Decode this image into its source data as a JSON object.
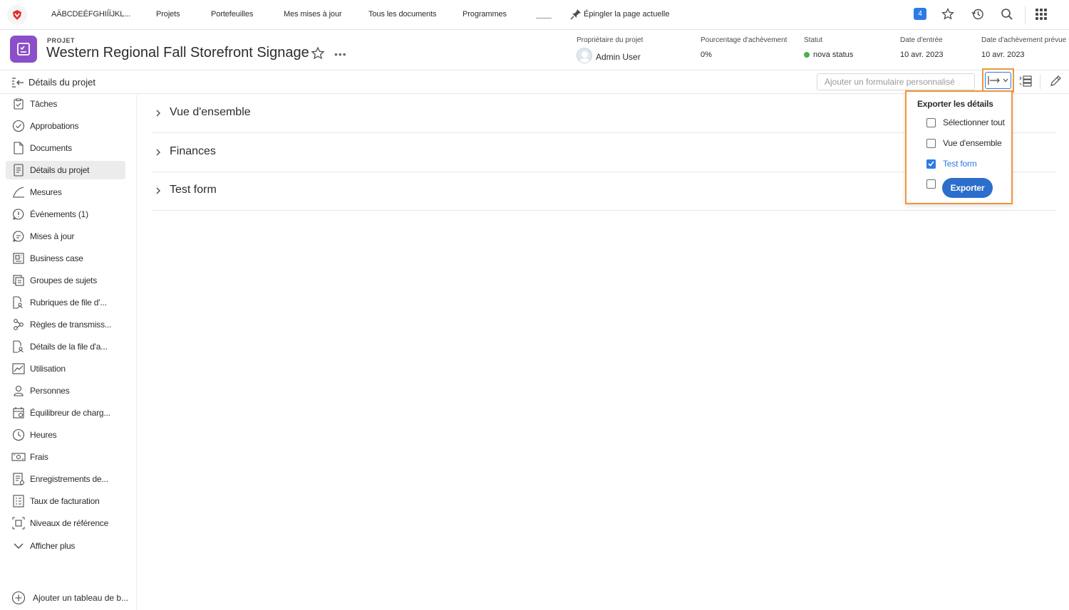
{
  "topnav": {
    "account_name": "AÄBCDEÉFGHIÍÏJKL...",
    "links": [
      "Projets",
      "Portefeuilles",
      "Mes mises à jour",
      "Tous les documents",
      "Programmes"
    ],
    "pin_label": "Épingler la page actuelle",
    "notification_count": "4"
  },
  "project": {
    "type_label": "PROJET",
    "title": "Western Regional Fall Storefront Signage",
    "more": "•••",
    "meta": {
      "owner_label": "Propriétaire du projet",
      "owner_value": "Admin User",
      "percent_label": "Pourcentage d'achèvement",
      "percent_value": "0%",
      "status_label": "Statut",
      "status_value": "nova status",
      "entry_label": "Date d'entrée",
      "entry_value": "10 avr. 2023",
      "planned_label": "Date d'achèvement prévue",
      "planned_value": "10 avr. 2023"
    },
    "status_color": "#4caf50"
  },
  "toolbar": {
    "section_title": "Détails du projet",
    "form_placeholder": "Ajouter un formulaire personnalisé"
  },
  "sidebar": {
    "items": [
      {
        "label": "Tâches",
        "icon": "tasks-icon"
      },
      {
        "label": "Approbations",
        "icon": "approvals-icon"
      },
      {
        "label": "Documents",
        "icon": "document-icon"
      },
      {
        "label": "Détails du projet",
        "icon": "details-icon",
        "active": true
      },
      {
        "label": "Mesures",
        "icon": "measures-icon"
      },
      {
        "label": "Événements (1)",
        "icon": "events-icon"
      },
      {
        "label": "Mises à jour",
        "icon": "updates-icon"
      },
      {
        "label": "Business case",
        "icon": "business-case-icon"
      },
      {
        "label": "Groupes de sujets",
        "icon": "topic-groups-icon"
      },
      {
        "label": "Rubriques de file d'...",
        "icon": "queue-topics-icon"
      },
      {
        "label": "Règles de transmiss...",
        "icon": "routing-rules-icon"
      },
      {
        "label": "Détails de la file d'a...",
        "icon": "queue-details-icon"
      },
      {
        "label": "Utilisation",
        "icon": "utilization-icon"
      },
      {
        "label": "Personnes",
        "icon": "people-icon"
      },
      {
        "label": "Équilibreur de charg...",
        "icon": "load-balancer-icon"
      },
      {
        "label": "Heures",
        "icon": "clock-icon"
      },
      {
        "label": "Frais",
        "icon": "expenses-icon"
      },
      {
        "label": "Enregistrements de...",
        "icon": "records-icon"
      },
      {
        "label": "Taux de facturation",
        "icon": "billing-rates-icon"
      },
      {
        "label": "Niveaux de référence",
        "icon": "baselines-icon"
      },
      {
        "label": "Afficher plus",
        "icon": "chevron-down-icon"
      }
    ],
    "add_dashboard": "Ajouter un tableau de b..."
  },
  "sections": [
    "Vue d'ensemble",
    "Finances",
    "Test form"
  ],
  "export_menu": {
    "title": "Exporter les détails",
    "options": [
      {
        "label": "Sélectionner tout",
        "checked": false
      },
      {
        "label": "Vue d'ensemble",
        "checked": false
      },
      {
        "label": "Test form",
        "checked": true
      },
      {
        "label": "",
        "checked": false
      }
    ],
    "button_label": "Exporter"
  },
  "colors": {
    "accent": "#2c7be5",
    "highlight": "#f0963a",
    "brand_purple": "#8a4fc9",
    "logo_red": "#e0302b"
  }
}
